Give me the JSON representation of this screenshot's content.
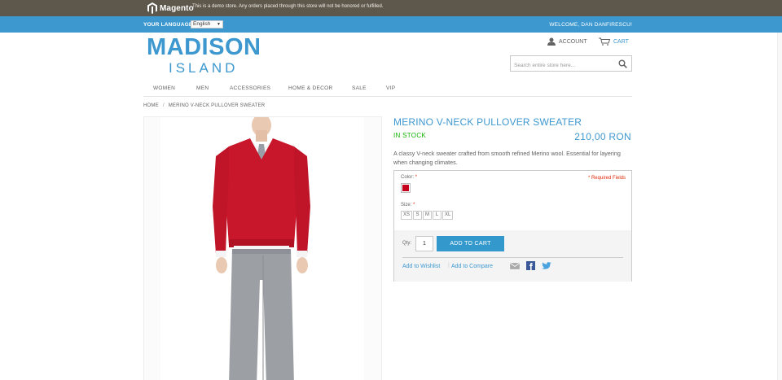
{
  "demo_bar": {
    "logo_text": "Magento",
    "notice": "This is a demo store. Any orders placed through this store will not be honored or fulfilled."
  },
  "header": {
    "language_label": "YOUR LANGUAGE:",
    "language_value": "English",
    "welcome": "WELCOME, DAN DANFIRESCU!"
  },
  "brand": {
    "main": "MADISON",
    "sub": "ISLAND"
  },
  "account": {
    "account_label": "ACCOUNT",
    "cart_label": "CART",
    "search_placeholder": "Search entire store here..."
  },
  "nav": [
    "WOMEN",
    "MEN",
    "ACCESSORIES",
    "HOME & DECOR",
    "SALE",
    "VIP"
  ],
  "breadcrumb": {
    "home": "HOME",
    "separator": "/",
    "current": "MERINO V-NECK PULLOVER SWEATER"
  },
  "product": {
    "name": "MERINO V-NECK PULLOVER SWEATER",
    "stock": "IN STOCK",
    "price": "210,00 RON",
    "description": "A classy V-neck sweater crafted from smooth refined Merino wool. Essential for layering when changing climates.",
    "color_label": "Color:",
    "required_star": "*",
    "required_note": "* Required Fields",
    "swatch_color": "#c4001c",
    "size_label": "Size:",
    "sizes": [
      "XS",
      "S",
      "M",
      "L",
      "XL"
    ],
    "qty_label": "Qty:",
    "qty_value": "1",
    "add_to_cart": "ADD TO CART",
    "wishlist": "Add to Wishlist",
    "compare_sep": "|",
    "compare": "Add to Compare"
  },
  "colors": {
    "accent": "#3d98cf",
    "demo_bar": "#5e584c",
    "in_stock": "#11b400",
    "required": "#df280a"
  }
}
